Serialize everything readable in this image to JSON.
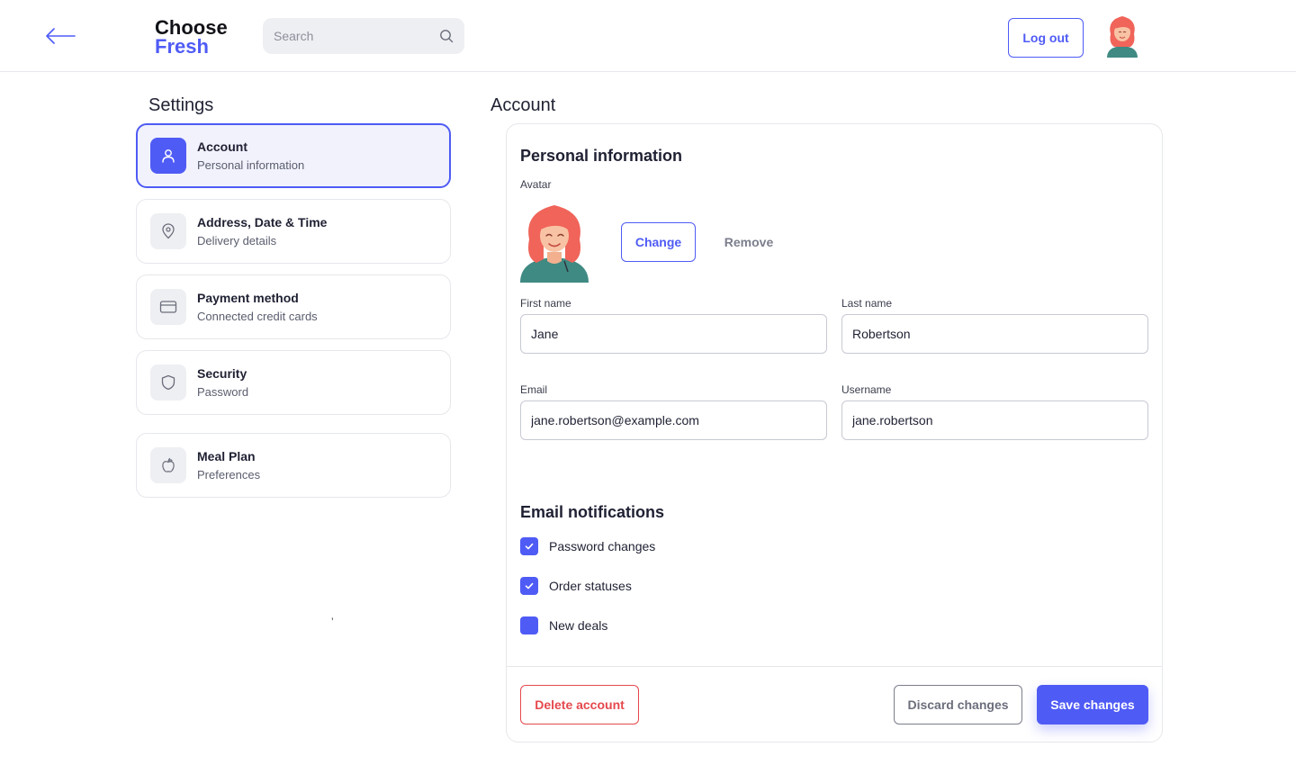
{
  "colors": {
    "accent": "#4f5bf5",
    "danger": "#e5484d",
    "active_nav_bg": "#f1f2fc",
    "icon_bg": "#eeeff2",
    "border": "#e6e7ec"
  },
  "header": {
    "back_icon": "arrow-left-icon",
    "logo_line1": "Choose",
    "logo_line2": "Fresh",
    "search_placeholder": "Search",
    "search_icon": "search-icon",
    "logout_label": "Log out",
    "avatar_icon": "user-avatar"
  },
  "sidebar": {
    "title": "Settings",
    "items": [
      {
        "title": "Account",
        "subtitle": "Personal information",
        "icon": "user-icon",
        "active": true
      },
      {
        "title": "Address, Date & Time",
        "subtitle": "Delivery details",
        "icon": "map-pin-icon",
        "active": false
      },
      {
        "title": "Payment method",
        "subtitle": "Connected credit cards",
        "icon": "credit-card-icon",
        "active": false
      },
      {
        "title": "Security",
        "subtitle": "Password",
        "icon": "shield-icon",
        "active": false
      },
      {
        "title": "Meal Plan",
        "subtitle": "Preferences",
        "icon": "apple-icon",
        "active": false
      }
    ],
    "stray_mark": "’"
  },
  "main": {
    "title": "Account",
    "personal": {
      "title": "Personal information",
      "avatar_label": "Avatar",
      "change_label": "Change",
      "remove_label": "Remove",
      "first_name_label": "First name",
      "first_name_value": "Jane",
      "last_name_label": "Last name",
      "last_name_value": "Robertson",
      "email_label": "Email",
      "email_value": "jane.robertson@example.com",
      "username_label": "Username",
      "username_value": "jane.robertson"
    },
    "notifications": {
      "title": "Email notifications",
      "items": [
        {
          "label": "Password changes",
          "checked": true
        },
        {
          "label": "Order statuses",
          "checked": true
        },
        {
          "label": "New deals",
          "checked": false
        }
      ]
    },
    "footer": {
      "delete_label": "Delete account",
      "discard_label": "Discard changes",
      "save_label": "Save changes"
    }
  }
}
